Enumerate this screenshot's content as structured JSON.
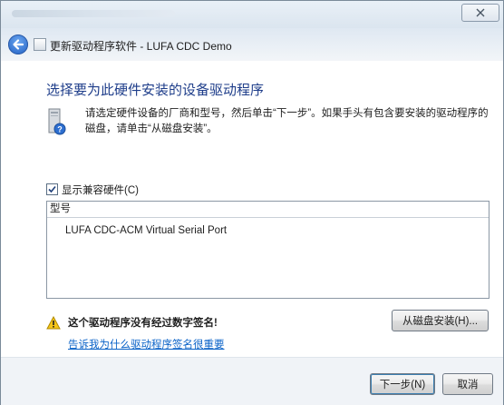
{
  "window": {
    "close_symbol": "☒"
  },
  "nav": {
    "back_icon": "back-arrow-icon",
    "title": "更新驱动程序软件 - LUFA CDC Demo"
  },
  "content": {
    "heading": "选择要为此硬件安装的设备驱动程序",
    "instruction": "请选定硬件设备的厂商和型号，然后单击“下一步”。如果手头有包含要安装的驱动程序的磁盘，请单击“从磁盘安装”。",
    "show_compatible": {
      "label": "显示兼容硬件(C)",
      "checked": true
    },
    "list": {
      "header": "型号",
      "items": [
        "LUFA CDC-ACM Virtual Serial Port"
      ]
    },
    "warning": {
      "text": "这个驱动程序没有经过数字签名!",
      "link": "告诉我为什么驱动程序签名很重要"
    },
    "have_disk_button": "从磁盘安装(H)..."
  },
  "footer": {
    "next_button": "下一步(N)",
    "cancel_button": "取消"
  },
  "colors": {
    "heading": "#1e3d8a",
    "link": "#0b63c8",
    "accent": "#1f5ec2"
  }
}
